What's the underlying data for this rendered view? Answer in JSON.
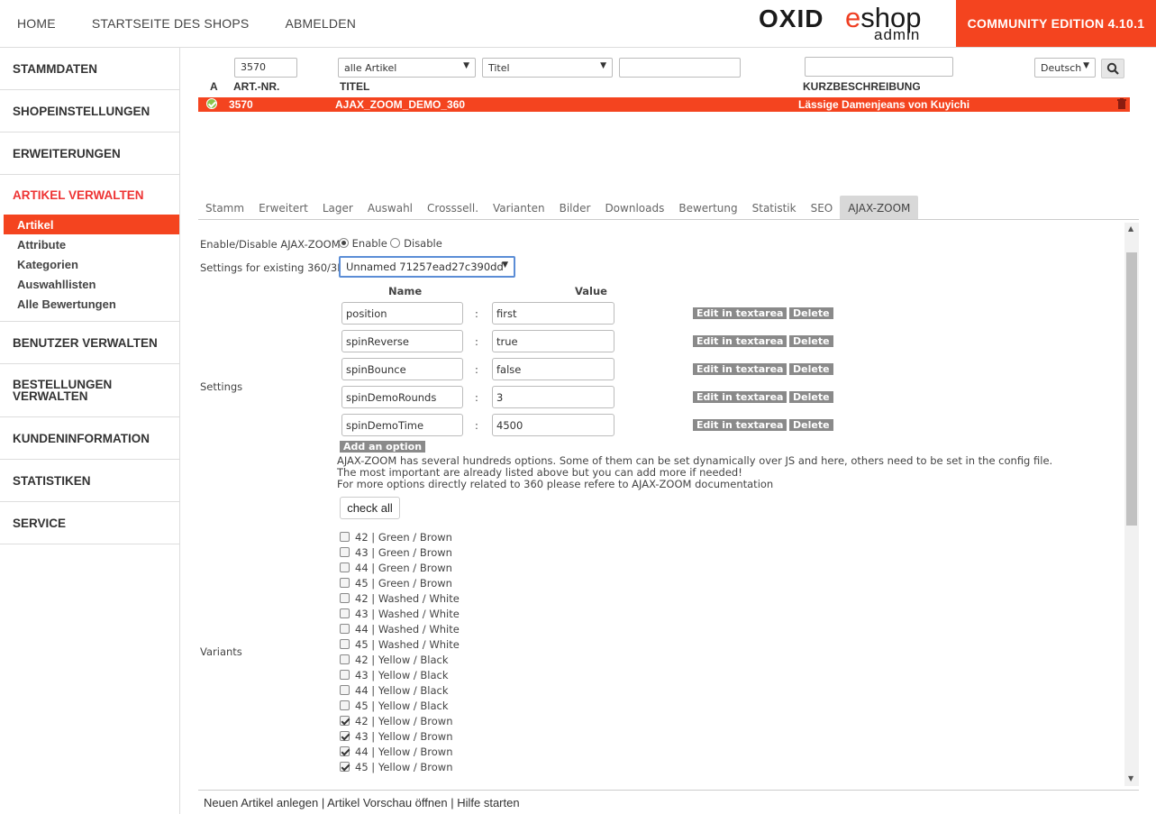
{
  "topnav": {
    "home": "HOME",
    "shop_start": "STARTSEITE DES SHOPS",
    "logout": "ABMELDEN"
  },
  "logo": {
    "oxid": "OXID",
    "e": "e",
    "shop": "shop",
    "admin": "admin"
  },
  "edition": "COMMUNITY EDITION 4.10.1",
  "sidebar": {
    "stammdaten": "STAMMDATEN",
    "shopeinstellungen": "SHOPEINSTELLUNGEN",
    "erweiterungen": "ERWEITERUNGEN",
    "artikel_verwalten": "ARTIKEL VERWALTEN",
    "sub": [
      "Artikel",
      "Attribute",
      "Kategorien",
      "Auswahllisten",
      "Alle Bewertungen"
    ],
    "benutzer": "BENUTZER VERWALTEN",
    "bestellungen_1": "BESTELLUNGEN",
    "bestellungen_2": "VERWALTEN",
    "kunden": "KUNDENINFORMATION",
    "statistiken": "STATISTIKEN",
    "service": "SERVICE"
  },
  "filters": {
    "artnr_value": "3570",
    "category_select": "alle Artikel",
    "field_select": "Titel",
    "title_value": "",
    "desc_value": "",
    "language_select": "Deutsch"
  },
  "columns": {
    "a": "A",
    "artnr": "ART.-NR.",
    "titel": "TITEL",
    "kurz": "KURZBESCHREIBUNG"
  },
  "row": {
    "artnr": "3570",
    "titel": "AJAX_ZOOM_DEMO_360",
    "kurz": "Lässige Damenjeans von Kuyichi"
  },
  "tabs": [
    "Stamm",
    "Erweitert",
    "Lager",
    "Auswahl",
    "Crosssell.",
    "Varianten",
    "Bilder",
    "Downloads",
    "Bewertung",
    "Statistik",
    "SEO",
    "AJAX-ZOOM"
  ],
  "form": {
    "enable_label": "Enable/Disable AJAX-ZOOM",
    "enable": "Enable",
    "disable": "Disable",
    "settings360_label": "Settings for existing 360/3D",
    "settings360_value": "Unnamed 71257ead27c390dd",
    "col_name": "Name",
    "col_value": "Value",
    "settings_label": "Settings",
    "colon": ":",
    "options": [
      {
        "name": "position",
        "value": "first"
      },
      {
        "name": "spinReverse",
        "value": "true"
      },
      {
        "name": "spinBounce",
        "value": "false"
      },
      {
        "name": "spinDemoRounds",
        "value": "3"
      },
      {
        "name": "spinDemoTime",
        "value": "4500"
      }
    ],
    "edit_btn": "Edit in textarea",
    "delete_btn": "Delete",
    "add_option": "Add an option",
    "desc_1": "AJAX-ZOOM has several hundreds options. Some of them can be set dynamically over JS and here, others need to be set in the config file.",
    "desc_2": "The most important are already listed above but you can add more if needed!",
    "desc_3": "For more options directly related to 360 please refere to AJAX-ZOOM documentation",
    "check_all": "check all",
    "variants_label": "Variants",
    "variants": [
      {
        "label": "42 | Green / Brown",
        "checked": false
      },
      {
        "label": "43 | Green / Brown",
        "checked": false
      },
      {
        "label": "44 | Green / Brown",
        "checked": false
      },
      {
        "label": "45 | Green / Brown",
        "checked": false
      },
      {
        "label": "42 | Washed / White",
        "checked": false
      },
      {
        "label": "43 | Washed / White",
        "checked": false
      },
      {
        "label": "44 | Washed / White",
        "checked": false
      },
      {
        "label": "45 | Washed / White",
        "checked": false
      },
      {
        "label": "42 | Yellow / Black",
        "checked": false
      },
      {
        "label": "43 | Yellow / Black",
        "checked": false
      },
      {
        "label": "44 | Yellow / Black",
        "checked": false
      },
      {
        "label": "45 | Yellow / Black",
        "checked": false
      },
      {
        "label": "42 | Yellow / Brown",
        "checked": true
      },
      {
        "label": "43 | Yellow / Brown",
        "checked": true
      },
      {
        "label": "44 | Yellow / Brown",
        "checked": true
      },
      {
        "label": "45 | Yellow / Brown",
        "checked": true
      }
    ]
  },
  "footer": {
    "new_article": "Neuen Artikel anlegen",
    "sep": "|",
    "preview": "Artikel Vorschau öffnen",
    "help": "Hilfe starten"
  },
  "colors": {
    "accent": "#f4441f",
    "active_text": "#ee3333",
    "button_gray": "#8a8a8a"
  }
}
